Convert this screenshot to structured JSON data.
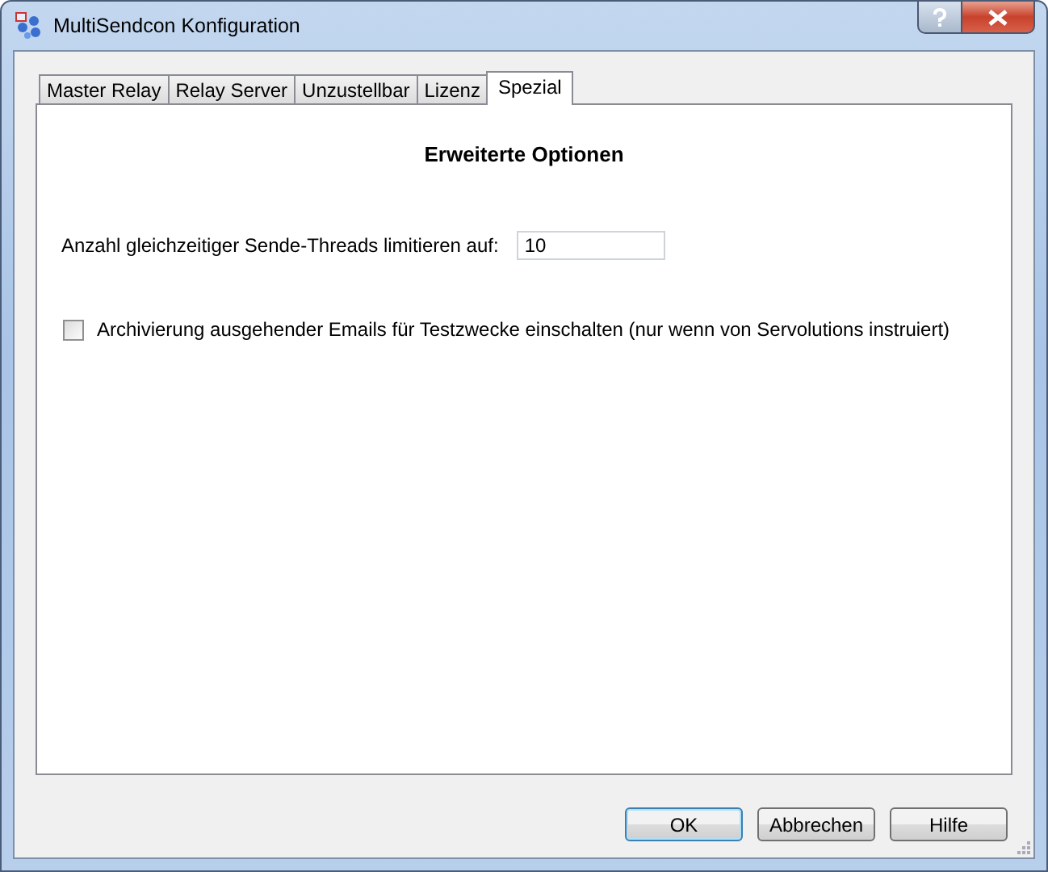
{
  "window": {
    "title": "MultiSendcon Konfiguration"
  },
  "tabs": [
    {
      "label": "Master Relay",
      "selected": false
    },
    {
      "label": "Relay Server",
      "selected": false
    },
    {
      "label": "Unzustellbar",
      "selected": false
    },
    {
      "label": "Lizenz",
      "selected": false
    },
    {
      "label": "Spezial",
      "selected": true
    }
  ],
  "panel": {
    "heading": "Erweiterte Optionen",
    "thread_limit": {
      "label": "Anzahl gleichzeitiger Sende-Threads limitieren auf:",
      "value": "10"
    },
    "archive": {
      "label": "Archivierung ausgehender Emails für Testzwecke einschalten (nur wenn von Servolutions instruiert)",
      "checked": false
    }
  },
  "buttons": [
    {
      "label": "OK",
      "default": true
    },
    {
      "label": "Abbrechen",
      "default": false
    },
    {
      "label": "Hilfe",
      "default": false
    }
  ]
}
